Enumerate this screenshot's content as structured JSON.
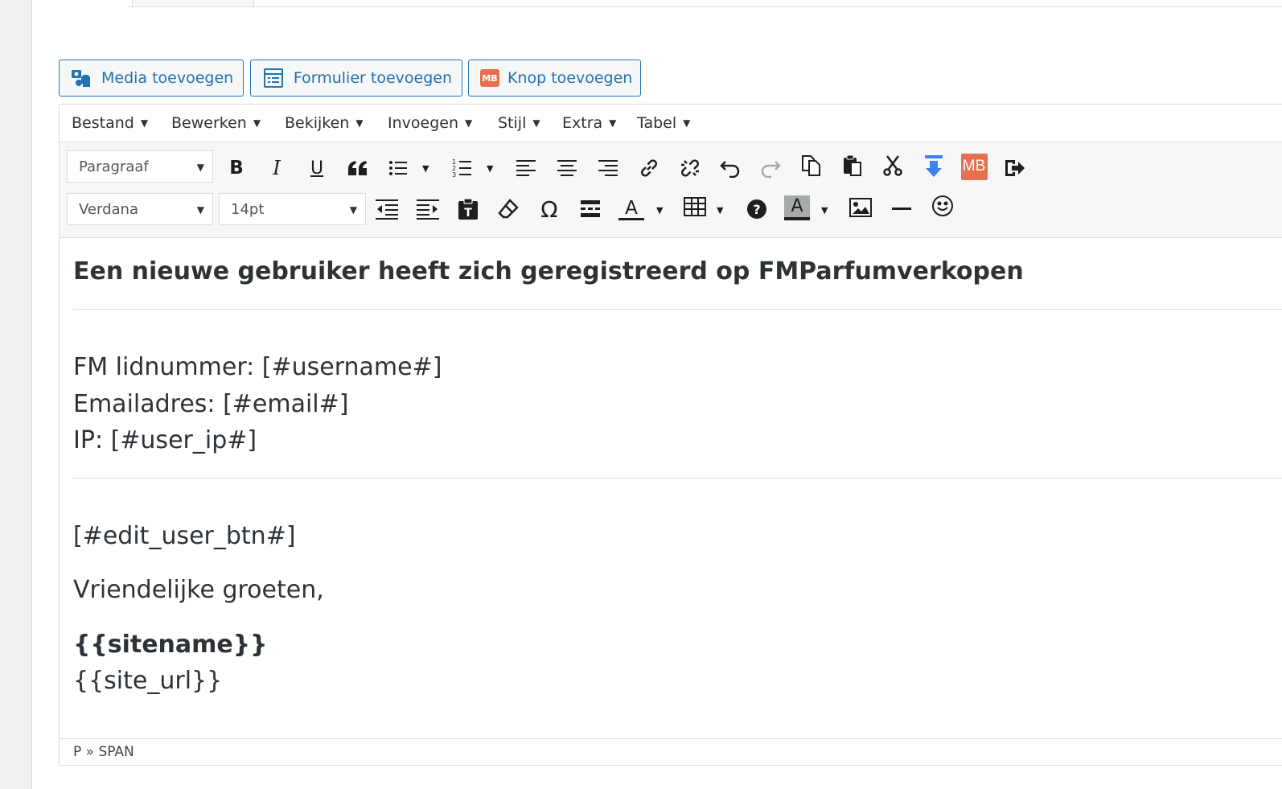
{
  "media_buttons": {
    "media": "Media toevoegen",
    "form": "Formulier toevoegen",
    "button": "Knop toevoegen",
    "mb_badge": "MB"
  },
  "menubar": {
    "items": [
      "Bestand",
      "Bewerken",
      "Bekijken",
      "Invoegen",
      "Stijl",
      "Extra",
      "Tabel"
    ]
  },
  "toolbar": {
    "format_select": "Paragraaf",
    "font_select": "Verdana",
    "size_select": "14pt",
    "mb_icon_text": "MB",
    "text_color_letter": "A",
    "bg_color_letter": "A",
    "special_char": "Ω",
    "icons_row1": [
      "bold-icon",
      "italic-icon",
      "underline-icon",
      "blockquote-icon",
      "bullet-list-icon",
      "numbered-list-icon",
      "align-left-icon",
      "align-center-icon",
      "align-right-icon",
      "link-icon",
      "unlink-icon",
      "undo-icon",
      "redo-icon",
      "copy-icon",
      "paste-icon",
      "cut-icon",
      "download-arrow-icon",
      "mb-icon",
      "exit-icon"
    ],
    "icons_row2": [
      "outdent-icon",
      "indent-icon",
      "paste-text-icon",
      "eraser-icon",
      "omega-icon",
      "page-break-icon",
      "text-color-icon",
      "table-icon",
      "help-icon",
      "background-color-icon",
      "image-icon",
      "horizontal-rule-icon",
      "emoticon-icon"
    ]
  },
  "content": {
    "heading": "Een nieuwe gebruiker heeft zich geregistreerd op FMParfumverkopen",
    "line_username": "FM lidnummer: [#username#]",
    "line_email": "Emailadres: [#email#]",
    "line_ip": "IP: [#user_ip#]",
    "line_edit_btn": "[#edit_user_btn#]",
    "line_greeting": "Vriendelijke groeten,",
    "line_sitename": "{{sitename}}",
    "line_siteurl": "{{site_url}}"
  },
  "statusbar": {
    "path": "P » SPAN"
  },
  "colors": {
    "accent": "#2271b1",
    "mb_orange": "#e8704f",
    "download_blue": "#3b82f6"
  }
}
